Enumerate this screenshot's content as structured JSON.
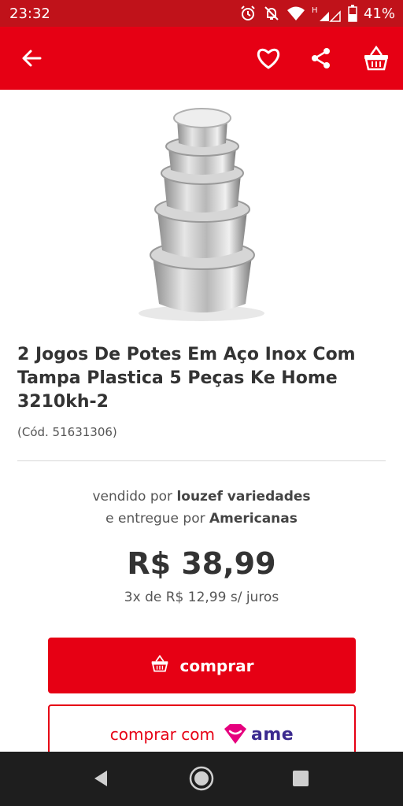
{
  "status_bar": {
    "time": "23:32",
    "battery": "41%",
    "icons": [
      "alarm-icon",
      "mute-icon",
      "wifi-icon",
      "signal-h-icon",
      "signal-icon",
      "battery-icon"
    ]
  },
  "app_bar": {
    "icons": [
      "back-arrow-icon",
      "heart-icon",
      "share-icon",
      "basket-icon"
    ]
  },
  "product": {
    "title": "2 Jogos De Potes Em Aço Inox Com Tampa Plastica 5 Peças Ke Home 3210kh-2",
    "code": "(Cód. 51631306)",
    "image": "stainless-steel-bowl-stack"
  },
  "seller": {
    "sold_prefix": "vendido por ",
    "sold_by": "louzef variedades",
    "delivered_prefix": "e entregue por ",
    "delivered_by": "Americanas"
  },
  "pricing": {
    "price": "R$ 38,99",
    "installments": "3x de R$ 12,99 s/ juros"
  },
  "actions": {
    "buy_label": "comprar",
    "buy_ame_label": "comprar com",
    "ame_logo": "ame"
  },
  "colors": {
    "brand_red": "#e60014",
    "status_bar": "#c0121a",
    "ame_purple": "#3b2a8f",
    "ame_pink": "#e6007e"
  },
  "nav_bar": {
    "icons": [
      "nav-back-icon",
      "nav-home-icon",
      "nav-recents-icon"
    ]
  }
}
